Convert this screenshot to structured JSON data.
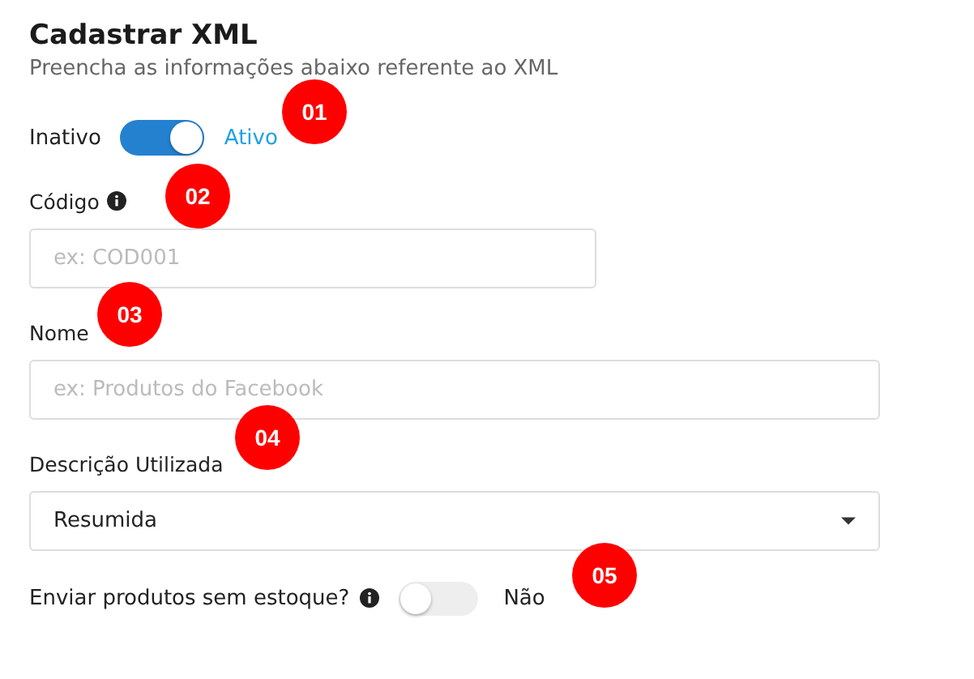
{
  "title": "Cadastrar XML",
  "subtitle": "Preencha as informações abaixo referente ao XML",
  "status_toggle": {
    "off_label": "Inativo",
    "on_label": "Ativo",
    "on": true,
    "marker": "01"
  },
  "fields": [
    {
      "kind": "short_text",
      "label": "Código",
      "info": true,
      "placeholder": "ex: COD001",
      "marker": "02"
    },
    {
      "kind": "text",
      "label": "Nome",
      "info": false,
      "placeholder": "ex: Produtos do Facebook",
      "marker": "03"
    },
    {
      "kind": "select",
      "label": "Descrição Utilizada",
      "info": false,
      "value": "Resumida",
      "marker": "04"
    }
  ],
  "stock_toggle": {
    "label": "Enviar produtos sem estoque?",
    "info": true,
    "on": false,
    "state_label": "Não",
    "marker": "05"
  }
}
